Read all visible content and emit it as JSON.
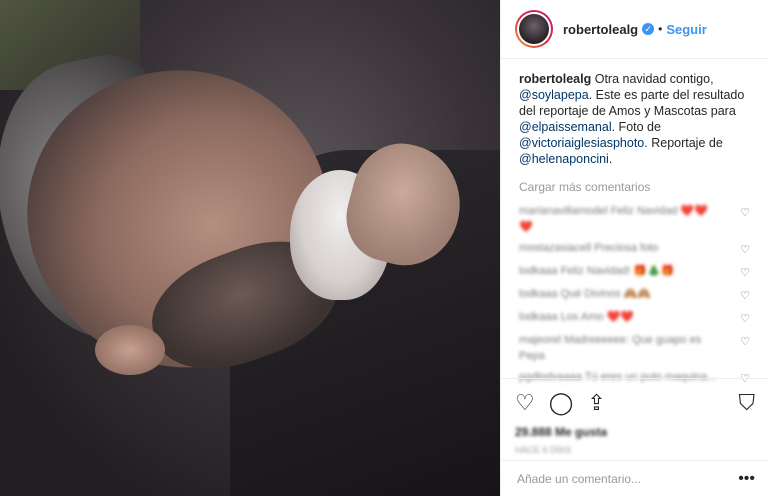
{
  "header": {
    "username": "robertolealg",
    "separator": "•",
    "follow_label": "Seguir"
  },
  "caption": {
    "username": "robertolealg",
    "text1": "Otra navidad contigo,",
    "mention1": "@soylapepa",
    "text2": ". Este es parte del resultado del reportaje de Amos y Mascotas para",
    "mention2": "@elpaissemanal",
    "text3": ". Foto de",
    "mention3": "@victoriaiglesiasphoto",
    "text4": ". Reportaje de",
    "mention4": "@helenaponcini",
    "text5": "."
  },
  "load_more": "Cargar más comentarios",
  "comments": [
    {
      "text": "marianavillamodel Feliz Navidad ❤️❤️❤️"
    },
    {
      "text": "mostazasiacell Preciosa foto"
    },
    {
      "text": "lodkaaa Feliz Navidad! 🎁🎄🎁"
    },
    {
      "text": "lodkaaa Qué Divinos 🙈🙈"
    },
    {
      "text": "lodkaaa Los Amo ❤️❤️"
    },
    {
      "text": "majeorel Madreeeeee: Que guapo es Pepa"
    },
    {
      "text": "pgdlodvaaaa Tú eres un puto maquina... me veo idéntica en la..."
    }
  ],
  "icons": {
    "heart": "heart-icon",
    "comment": "comment-icon",
    "share": "share-icon",
    "bookmark": "bookmark-icon",
    "more": "more-icon"
  },
  "likes": "29.888 Me gusta",
  "time": "HACE 6 DÍAS",
  "add_comment": {
    "placeholder": "Añade un comentario...",
    "more_label": "•••"
  }
}
